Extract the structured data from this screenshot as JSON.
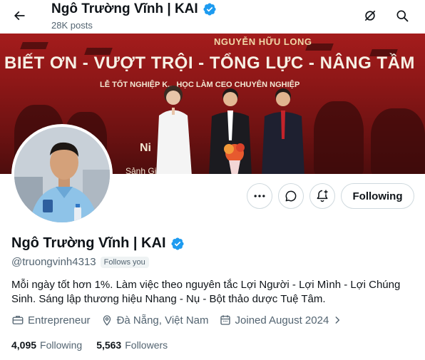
{
  "header": {
    "name": "Ngô Trường Vĩnh | KAI",
    "post_count": "28K posts"
  },
  "banner": {
    "top_text": "NGUYỄN HỮU LONG",
    "headline": "BIẾT ƠN - VƯỢT TRỘI - TỔNG LỰC - NÂNG TẦM",
    "subline": "LỄ TỐT NGHIỆP K... HỌC LÀM CEO CHUYÊN NGHIỆP",
    "ni_text": "Ni",
    "sanh_text": "Sảnh Gi"
  },
  "actions": {
    "follow_label": "Following"
  },
  "profile": {
    "name": "Ngô Trường Vĩnh | KAI",
    "handle": "@truongvinh4313",
    "follows_you": "Follows you",
    "bio": "Mỗi ngày tốt hơn 1%. Làm việc theo nguyên tắc Lợi Người - Lợi Mình - Lợi Chúng Sinh. Sáng lập thương hiệu Nhang - Nụ - Bột thảo dược Tuệ Tâm.",
    "profession": "Entrepreneur",
    "location": "Đà Nẵng, Việt Nam",
    "joined": "Joined August 2024"
  },
  "stats": {
    "following_count": "4,095",
    "following_label": "Following",
    "followers_count": "5,563",
    "followers_label": "Followers"
  },
  "icons": {
    "back": "arrow-left-icon",
    "grok": "grok-icon",
    "search": "search-icon",
    "verified": "verified-badge-icon",
    "more": "more-icon",
    "message": "message-icon",
    "notify": "bell-plus-icon",
    "profession": "briefcase-icon",
    "location": "location-pin-icon",
    "joined": "calendar-icon",
    "chevron": "chevron-right-icon"
  },
  "colors": {
    "verified_blue": "#1d9bf0",
    "text_primary": "#0f1419",
    "text_secondary": "#536471",
    "border": "#cfd9de"
  }
}
